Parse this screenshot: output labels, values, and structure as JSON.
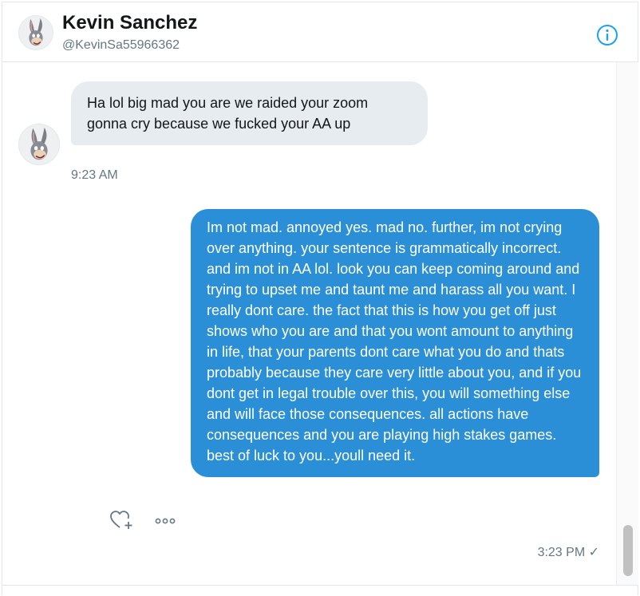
{
  "header": {
    "name": "Kevin Sanchez",
    "handle": "@KevinSa55966362",
    "info_icon": "info-circle-icon",
    "accent": "#1da1f2"
  },
  "messages": [
    {
      "direction": "incoming",
      "text": "Ha lol big mad you are we raided your zoom gonna cry because we fucked your AA up",
      "time": "9:23 AM"
    },
    {
      "direction": "outgoing",
      "text": "Im not mad. annoyed yes. mad no. further, im not crying over anything. your sentence is grammatically incorrect. and im not in AA lol. look you can keep coming around and trying to upset me and taunt me and harass all you want. I really dont care. the fact that this is how you get off just shows who you are and that you wont amount to anything in life, that your parents dont care what you do and thats probably because they care very little about you, and if you dont get in legal trouble over this, you will something else and will face those consequences. all actions have consequences and you are playing high stakes games. best of luck to you...youll need it.",
      "time": "3:23 PM ✓",
      "bubble_color": "#2b8fd8"
    }
  ],
  "actions": {
    "like_icon": "heart-plus-icon",
    "more_icon": "more-dots-icon"
  }
}
